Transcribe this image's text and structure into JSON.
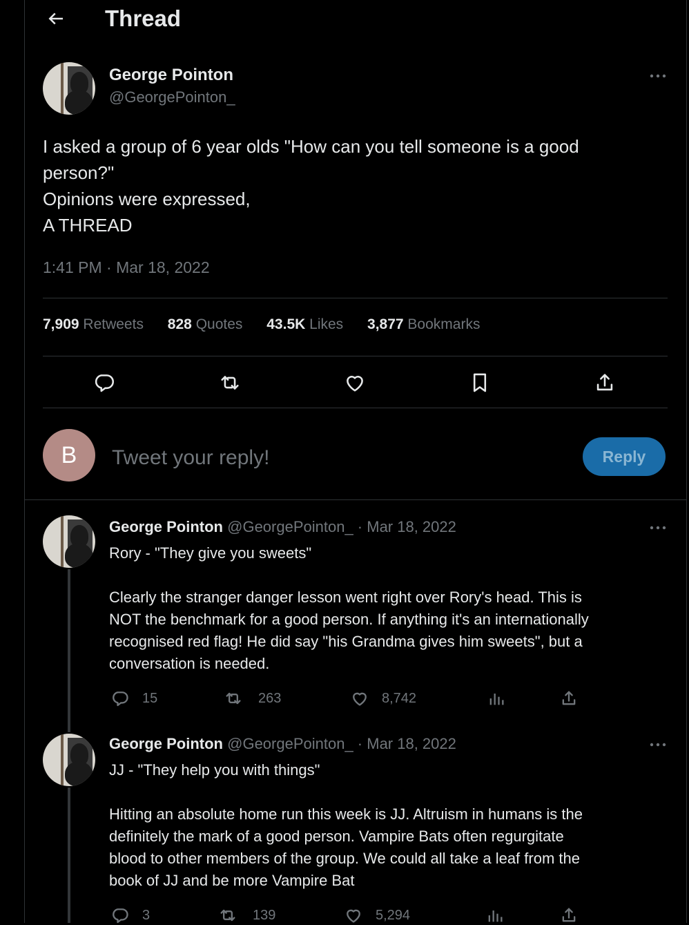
{
  "header": {
    "title": "Thread"
  },
  "main_tweet": {
    "author_name": "George Pointon",
    "author_handle": "@GeorgePointon_",
    "text_lines": [
      "I asked a group of 6 year olds \"How can you tell someone is a good",
      "person?\"",
      "Opinions were expressed,",
      "A THREAD"
    ],
    "timestamp": "1:41 PM · Mar 18, 2022",
    "stats": {
      "retweets_count": "7,909",
      "retweets_label": "Retweets",
      "quotes_count": "828",
      "quotes_label": "Quotes",
      "likes_count": "43.5K",
      "likes_label": "Likes",
      "bookmarks_count": "3,877",
      "bookmarks_label": "Bookmarks"
    }
  },
  "reply_box": {
    "avatar_letter": "B",
    "placeholder": "Tweet your reply!",
    "button_label": "Reply"
  },
  "replies": [
    {
      "author_name": "George Pointon",
      "meta": "@GeorgePointon_ · Mar 18, 2022",
      "lines": [
        "Rory - \"They give you sweets\"",
        "",
        "Clearly the stranger danger lesson went right over Rory's head. This is",
        "NOT the benchmark for a good person. If anything it's an internationally",
        "recognised red flag! He did say \"his Grandma gives him sweets\", but a",
        "conversation is needed."
      ],
      "replies_count": "15",
      "retweets_count": "263",
      "likes_count": "8,742"
    },
    {
      "author_name": "George Pointon",
      "meta": "@GeorgePointon_ · Mar 18, 2022",
      "lines": [
        "JJ - \"They help you with things\"",
        "",
        "Hitting an absolute home run this week is JJ. Altruism in humans is the",
        "definitely the mark of a good person. Vampire Bats often regurgitate",
        "blood to other members of the group. We could all take a leaf from the",
        "book of JJ and be more Vampire Bat"
      ],
      "replies_count": "3",
      "retweets_count": "139",
      "likes_count": "5,294"
    }
  ],
  "colors": {
    "background": "#000000",
    "text": "#e7e9ea",
    "muted": "#71767b",
    "border": "#2f3336",
    "reply_button": "#1a6ca8",
    "reply_avatar": "#b48b86"
  }
}
